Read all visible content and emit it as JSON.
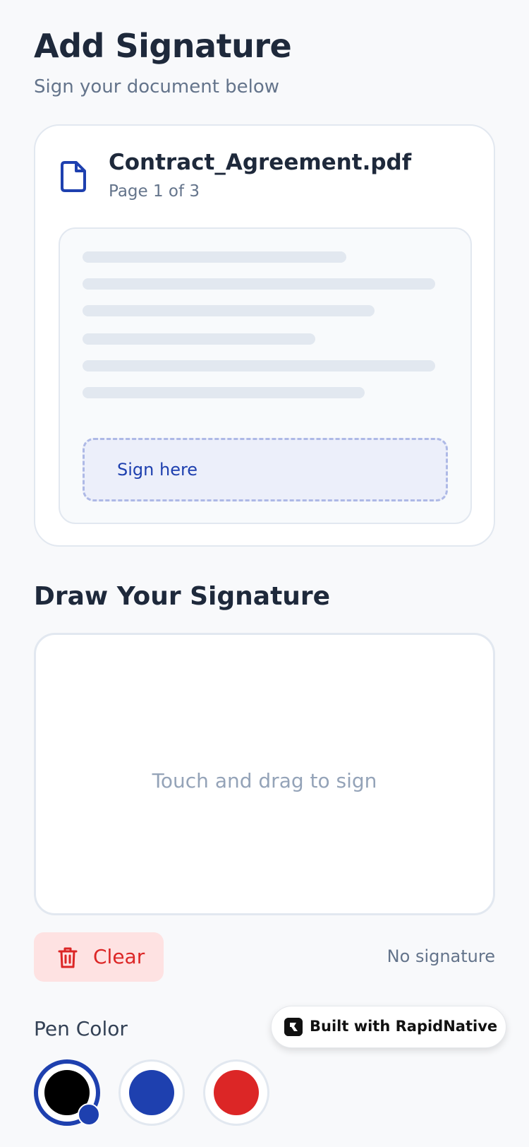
{
  "header": {
    "title": "Add Signature",
    "subtitle": "Sign your document below"
  },
  "document": {
    "icon": "file-icon",
    "name": "Contract_Agreement.pdf",
    "page_info": "Page 1 of 3",
    "sign_zone_label": "Sign here"
  },
  "signature_pad": {
    "title": "Draw Your Signature",
    "placeholder": "Touch and drag to sign"
  },
  "actions": {
    "clear_label": "Clear",
    "clear_icon": "trash-icon",
    "status": "No signature"
  },
  "pen": {
    "label": "Pen Color",
    "colors": [
      {
        "name": "black",
        "hex": "#000000",
        "selected": true
      },
      {
        "name": "blue",
        "hex": "#1e40af",
        "selected": false
      },
      {
        "name": "red",
        "hex": "#dc2626",
        "selected": false
      }
    ]
  },
  "badge": {
    "text": "Built with RapidNative",
    "icon": "rapidnative-logo-icon"
  },
  "colors": {
    "accent": "#1e40af",
    "danger": "#dc2626",
    "danger_bg": "#fee2e2",
    "background": "#f8f9fb"
  }
}
